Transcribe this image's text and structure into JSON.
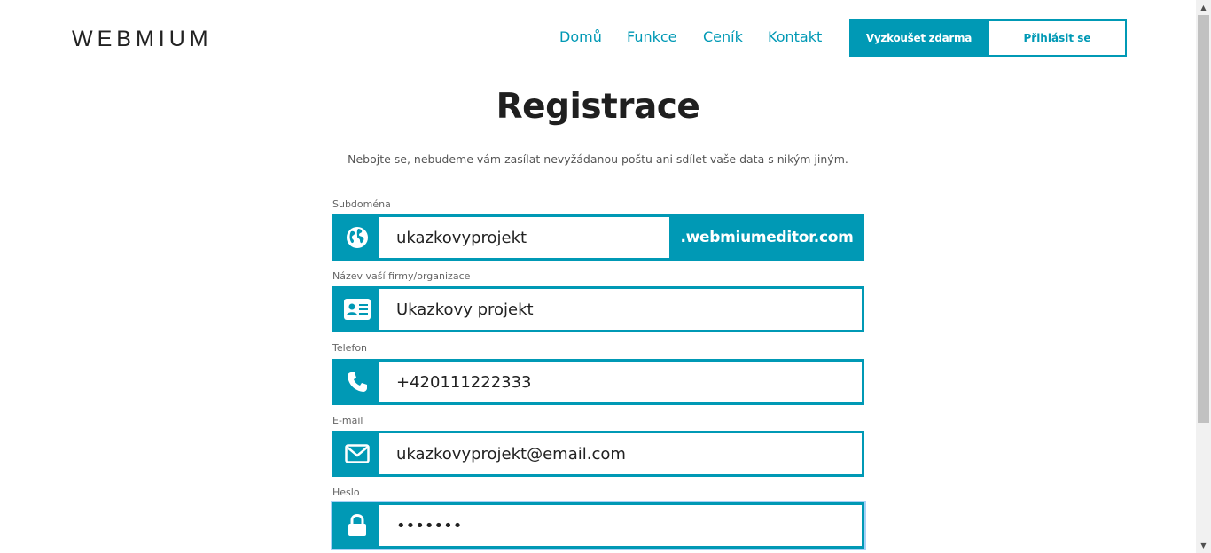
{
  "header": {
    "logo": "WEBMIUM",
    "nav": [
      "Domů",
      "Funkce",
      "Ceník",
      "Kontakt"
    ],
    "try_label": "Vyzkoušet zdarma",
    "login_label": "Přihlásit se"
  },
  "main": {
    "title": "Registrace",
    "subtitle": "Nebojte se, nebudeme vám zasílat nevyžádanou poštu ani sdílet vaše data s nikým jiným."
  },
  "form": {
    "subdomain": {
      "label": "Subdoména",
      "value": "ukazkovyprojekt",
      "suffix": ".webmiumeditor.com",
      "icon": "globe-icon"
    },
    "company": {
      "label": "Název vaší firmy/organizace",
      "value": "Ukazkovy projekt",
      "icon": "id-card-icon"
    },
    "phone": {
      "label": "Telefon",
      "value": "+420111222333",
      "icon": "phone-icon"
    },
    "email": {
      "label": "E-mail",
      "value": "ukazkovyprojekt@email.com",
      "icon": "envelope-icon"
    },
    "password": {
      "label": "Heslo",
      "value": "•••••••",
      "icon": "lock-icon"
    }
  },
  "colors": {
    "accent": "#0099b5",
    "focus": "#a8d1f7"
  }
}
